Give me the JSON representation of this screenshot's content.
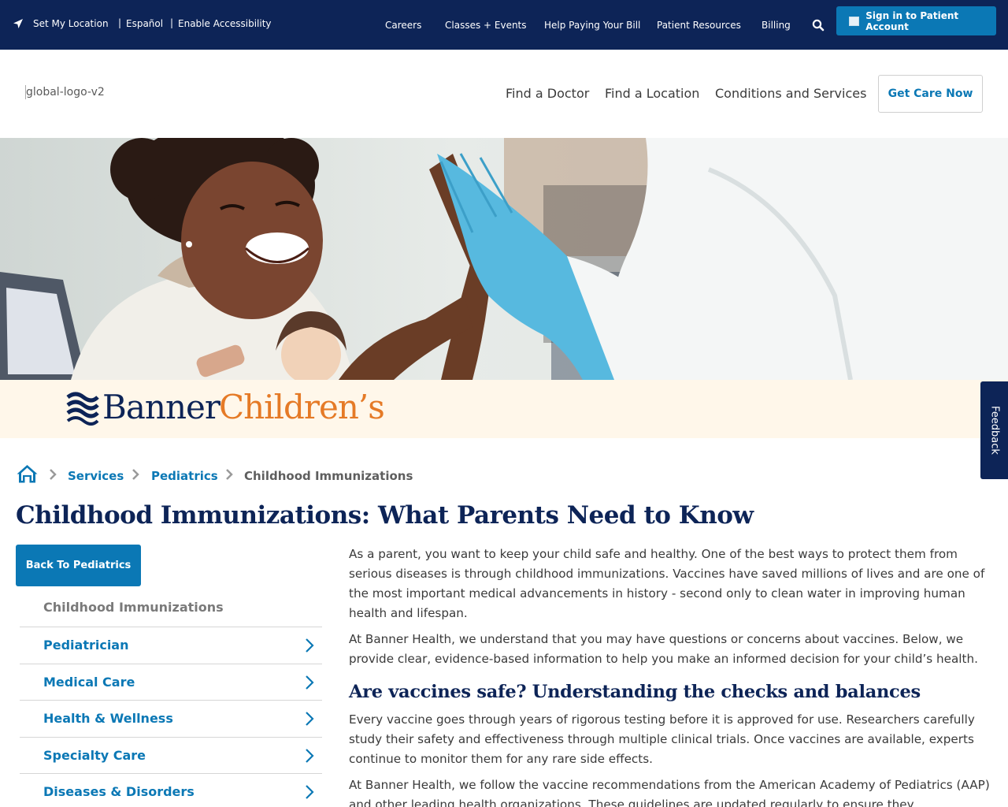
{
  "utility_bar": {
    "location": "Set My Location",
    "language": "Español",
    "accessibility": "Enable Accessibility",
    "links": [
      "Careers",
      "Classes + Events",
      "Help Paying Your Bill",
      "Patient Resources",
      "Billing"
    ],
    "signin": "Sign in to Patient Account"
  },
  "header": {
    "logo_alt": "global-logo-v2",
    "nav": [
      "Find a Doctor",
      "Find a Location",
      "Conditions and Services"
    ],
    "cta": "Get Care Now"
  },
  "brand": {
    "word1": "Banner",
    "word2": "Children’s"
  },
  "feedback": "Feedback",
  "breadcrumb": [
    "Services",
    "Pediatrics",
    "Childhood Immunizations"
  ],
  "page_title": "Childhood Immunizations: What Parents Need to Know",
  "sidebar": {
    "back": "Back To Pediatrics",
    "current": "Childhood Immunizations",
    "items": [
      "Pediatrician",
      "Medical Care",
      "Health & Wellness",
      "Specialty Care",
      "Diseases & Disorders"
    ]
  },
  "content": {
    "p1": "As a parent, you want to keep your child safe and healthy. One of the best ways to protect them from serious diseases is through childhood immunizations. Vaccines have saved millions of lives and are one of the most important medical advancements in history - second only to clean water in improving human health and lifespan.",
    "p2": "At Banner Health, we understand that you may have questions or concerns about vaccines. Below, we provide clear, evidence-based information to help you make an informed decision for your child’s health.",
    "h2": "Are vaccines safe? Understanding the checks and balances",
    "p3": "Every vaccine goes through years of rigorous testing before it is approved for use. Researchers carefully study their safety and effectiveness through multiple clinical trials. Once vaccines are available, experts continue to monitor them for any rare side effects.",
    "p4": "At Banner Health, we follow the vaccine recommendations from the American Academy of Pediatrics (AAP) and other leading health organizations. These guidelines are updated regularly to ensure they"
  },
  "colors": {
    "navy": "#0d2457",
    "blue": "#0b78b5",
    "orange": "#e57a26",
    "cream": "#fff7ea"
  }
}
